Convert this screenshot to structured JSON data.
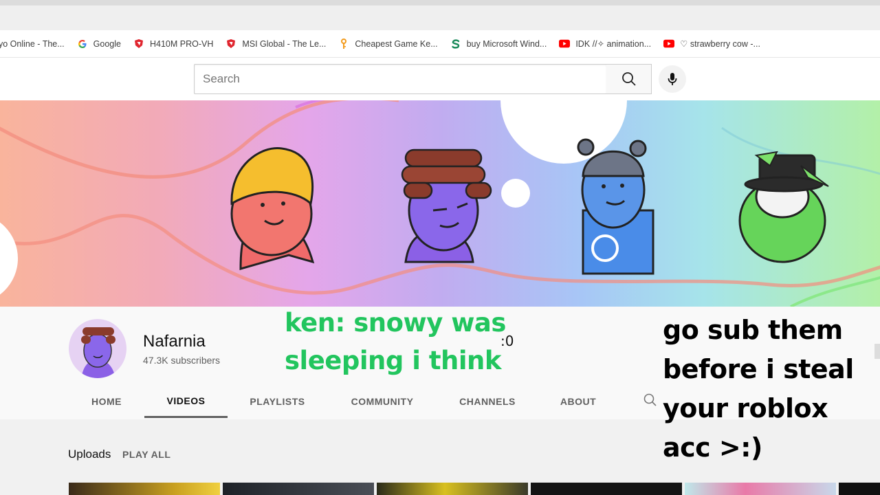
{
  "bookmarks": [
    {
      "label": "yo Online - The...",
      "icon": "none"
    },
    {
      "label": "Google",
      "icon": "google-icon"
    },
    {
      "label": "H410M PRO-VH",
      "icon": "msi-shield-icon"
    },
    {
      "label": "MSI Global - The Le...",
      "icon": "msi-shield-icon"
    },
    {
      "label": "Cheapest Game Ke...",
      "icon": "key-icon"
    },
    {
      "label": "buy Microsoft Wind...",
      "icon": "dollar-icon"
    },
    {
      "label": "IDK //✧ animation...",
      "icon": "youtube-icon"
    },
    {
      "label": "♡ strawberry cow -...",
      "icon": "youtube-icon"
    }
  ],
  "search": {
    "placeholder": "Search",
    "value": ""
  },
  "channel": {
    "name": "Nafarnia",
    "subscribers": "47.3K subscribers"
  },
  "tabs": [
    {
      "label": "HOME",
      "active": false
    },
    {
      "label": "VIDEOS",
      "active": true
    },
    {
      "label": "PLAYLISTS",
      "active": false
    },
    {
      "label": "COMMUNITY",
      "active": false
    },
    {
      "label": "CHANNELS",
      "active": false
    },
    {
      "label": "ABOUT",
      "active": false
    }
  ],
  "uploads": {
    "title": "Uploads",
    "play_all": "PLAY ALL"
  },
  "overlay": {
    "green_caption": "ken: snowy was sleeping i think",
    "small_note": ":0",
    "black_caption": "go sub them before i steal your roblox acc >:)"
  },
  "colors": {
    "green_caption": "#22c55e",
    "youtube_red": "#ff0000",
    "msi_red": "#e0262f"
  }
}
